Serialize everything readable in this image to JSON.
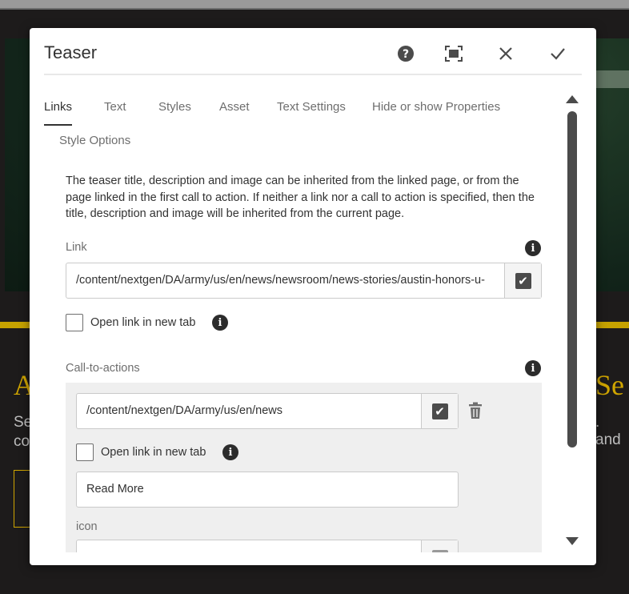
{
  "background": {
    "heading_left": "A",
    "heading_right": "Se",
    "sub_left_1": "Se",
    "sub_left_2": "co",
    "sub_right": ". and"
  },
  "dialog": {
    "title": "Teaser",
    "header_buttons": {
      "help_icon": "help-icon",
      "fullscreen_icon": "fullscreen-icon",
      "close_icon": "close-icon",
      "done_icon": "check-icon"
    },
    "tabs": [
      {
        "label": "Links",
        "active": true
      },
      {
        "label": "Text"
      },
      {
        "label": "Styles"
      },
      {
        "label": "Asset"
      },
      {
        "label": "Text Settings"
      },
      {
        "label": "Hide or show Properties"
      },
      {
        "label": "Style Options"
      }
    ],
    "description": "The teaser title, description and image can be inherited from the linked page, or from the page linked in the first call to action. If neither a link nor a call to action is specified, then the title, description and image will be inherited from the current page.",
    "link": {
      "label": "Link",
      "value": "/content/nextgen/DA/army/us/en/news/newsroom/news-stories/austin-honors-u-",
      "open_new_tab_label": "Open link in new tab",
      "open_new_tab_checked": false
    },
    "cta": {
      "label": "Call-to-actions",
      "item": {
        "link_value": "/content/nextgen/DA/army/us/en/news",
        "open_new_tab_label": "Open link in new tab",
        "open_new_tab_checked": false,
        "text_value": "Read More",
        "icon_label": "icon",
        "icon_value": ""
      }
    }
  }
}
